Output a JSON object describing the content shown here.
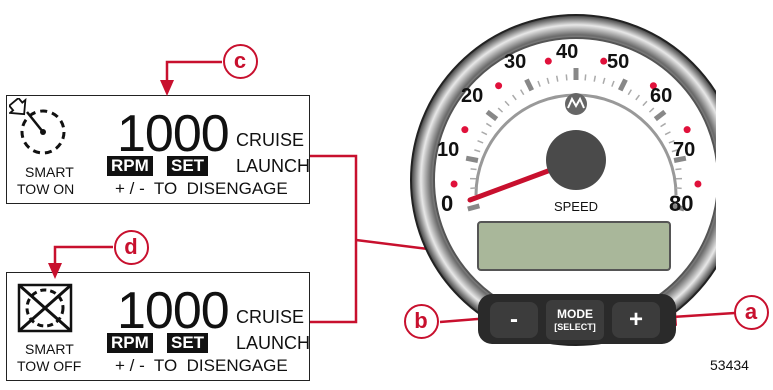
{
  "panel_top": {
    "rpm_value": "1000",
    "rpm_chip": "RPM",
    "set_chip": "SET",
    "mode_cruise": "CRUISE",
    "mode_launch": "LAUNCH",
    "instruction": "+ / -  TO  DISENGAGE",
    "status_line1": "SMART",
    "status_line2": "TOW ON",
    "callout": "c"
  },
  "panel_bottom": {
    "rpm_value": "1000",
    "rpm_chip": "RPM",
    "set_chip": "SET",
    "mode_cruise": "CRUISE",
    "mode_launch": "LAUNCH",
    "instruction": "+ / -  TO  DISENGAGE",
    "status_line1": "SMART",
    "status_line2": "TOW OFF",
    "callout": "d"
  },
  "gauge": {
    "label": "SPEED",
    "scale": [
      "0",
      "10",
      "20",
      "30",
      "40",
      "50",
      "60",
      "70",
      "80"
    ],
    "needle_value": 0,
    "buttons": {
      "minus": "-",
      "mode_line1": "MODE",
      "mode_line2": "[SELECT]",
      "plus": "+"
    },
    "callout_a": "a",
    "callout_b": "b"
  },
  "figure_number": "53434",
  "colors": {
    "callout_red": "#c8102e",
    "lcd_green": "#a9b79a",
    "bezel_dark": "#2a2a2a"
  }
}
